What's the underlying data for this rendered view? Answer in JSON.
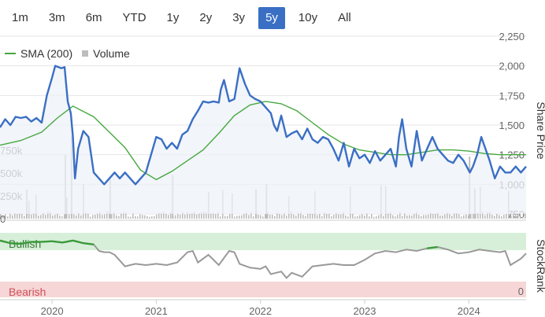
{
  "range_tabs": [
    {
      "label": "1m",
      "active": false
    },
    {
      "label": "3m",
      "active": false
    },
    {
      "label": "6m",
      "active": false
    },
    {
      "label": "YTD",
      "active": false
    },
    {
      "label": "1y",
      "active": false
    },
    {
      "label": "2y",
      "active": false
    },
    {
      "label": "3y",
      "active": false
    },
    {
      "label": "5y",
      "active": true
    },
    {
      "label": "10y",
      "active": false
    },
    {
      "label": "All",
      "active": false
    }
  ],
  "legend": {
    "sma_label": "SMA (200)",
    "volume_label": "Volume"
  },
  "colors": {
    "price": "#3a6fc4",
    "sma": "#46a83e",
    "volume": "#bdbdbd",
    "bullish_band": "#d7efd9",
    "bearish_band": "#f6d6d6",
    "bearish_text": "#d0505a",
    "bullish_text": "#3a7a3a",
    "stockrank_line": "#999999",
    "stockrank_bull": "#3a9a3a"
  },
  "chart_data": [
    {
      "type": "line",
      "ylabel": "Share Price",
      "y_ticks": [
        "2,250",
        "2,000",
        "1,750",
        "1,500",
        "1,250",
        "1,000",
        "750"
      ],
      "ylim": [
        750,
        2250
      ],
      "x_ticks": [
        "2020",
        "2021",
        "2022",
        "2023",
        "2024"
      ],
      "xlim": [
        2019.5,
        2024.55
      ],
      "series": [
        {
          "name": "SMA (200)",
          "x": [
            2019.5,
            2019.7,
            2019.9,
            2020.05,
            2020.2,
            2020.4,
            2020.55,
            2020.7,
            2020.85,
            2021.0,
            2021.15,
            2021.3,
            2021.45,
            2021.6,
            2021.75,
            2021.9,
            2022.05,
            2022.2,
            2022.35,
            2022.5,
            2022.65,
            2022.8,
            2022.95,
            2023.1,
            2023.25,
            2023.4,
            2023.55,
            2023.7,
            2023.85,
            2024.0,
            2024.15,
            2024.3,
            2024.45,
            2024.55
          ],
          "values": [
            1330,
            1370,
            1440,
            1560,
            1660,
            1570,
            1440,
            1310,
            1120,
            1040,
            1110,
            1200,
            1290,
            1430,
            1580,
            1670,
            1700,
            1680,
            1620,
            1520,
            1420,
            1340,
            1290,
            1270,
            1250,
            1250,
            1270,
            1290,
            1290,
            1280,
            1260,
            1250,
            1250,
            1250
          ]
        },
        {
          "name": "Price",
          "x": [
            2019.5,
            2019.55,
            2019.6,
            2019.65,
            2019.7,
            2019.75,
            2019.8,
            2019.85,
            2019.9,
            2019.95,
            2020.0,
            2020.03,
            2020.06,
            2020.09,
            2020.12,
            2020.15,
            2020.18,
            2020.2,
            2020.22,
            2020.25,
            2020.3,
            2020.35,
            2020.4,
            2020.45,
            2020.5,
            2020.55,
            2020.6,
            2020.65,
            2020.7,
            2020.75,
            2020.8,
            2020.85,
            2020.9,
            2020.95,
            2021.0,
            2021.05,
            2021.1,
            2021.15,
            2021.2,
            2021.25,
            2021.3,
            2021.35,
            2021.4,
            2021.45,
            2021.5,
            2021.55,
            2021.6,
            2021.62,
            2021.65,
            2021.7,
            2021.75,
            2021.8,
            2021.85,
            2021.9,
            2021.95,
            2022.0,
            2022.05,
            2022.1,
            2022.13,
            2022.16,
            2022.2,
            2022.25,
            2022.3,
            2022.35,
            2022.4,
            2022.45,
            2022.5,
            2022.55,
            2022.6,
            2022.65,
            2022.7,
            2022.75,
            2022.8,
            2022.85,
            2022.9,
            2022.95,
            2023.0,
            2023.05,
            2023.1,
            2023.15,
            2023.2,
            2023.25,
            2023.3,
            2023.33,
            2023.36,
            2023.4,
            2023.45,
            2023.5,
            2023.55,
            2023.6,
            2023.65,
            2023.7,
            2023.75,
            2023.8,
            2023.85,
            2023.9,
            2023.95,
            2023.98,
            2024.01,
            2024.04,
            2024.08,
            2024.12,
            2024.16,
            2024.2,
            2024.25,
            2024.3,
            2024.35,
            2024.4,
            2024.45,
            2024.5,
            2024.55
          ],
          "values": [
            1480,
            1550,
            1500,
            1570,
            1560,
            1570,
            1530,
            1560,
            1520,
            1750,
            1900,
            2000,
            1990,
            1980,
            1990,
            1700,
            1600,
            1400,
            1050,
            1300,
            1450,
            1400,
            1100,
            1050,
            1000,
            1050,
            1100,
            1050,
            1100,
            1050,
            1000,
            1050,
            1100,
            1250,
            1400,
            1380,
            1300,
            1350,
            1300,
            1420,
            1450,
            1550,
            1620,
            1700,
            1690,
            1700,
            1690,
            1800,
            1880,
            1700,
            1720,
            1980,
            1850,
            1750,
            1720,
            1700,
            1650,
            1600,
            1500,
            1450,
            1580,
            1400,
            1430,
            1450,
            1380,
            1470,
            1380,
            1350,
            1400,
            1380,
            1300,
            1200,
            1350,
            1150,
            1300,
            1220,
            1250,
            1180,
            1280,
            1200,
            1250,
            1300,
            1150,
            1400,
            1550,
            1300,
            1150,
            1450,
            1200,
            1300,
            1400,
            1300,
            1250,
            1200,
            1180,
            1250,
            1200,
            1150,
            1100,
            1150,
            1250,
            1400,
            1300,
            1200,
            1050,
            1150,
            1100,
            1100,
            1150,
            1100,
            1150
          ]
        }
      ]
    },
    {
      "type": "bar",
      "ylabel": "Volume",
      "y_ticks": [
        "750k",
        "500k",
        "250k",
        "0"
      ],
      "ylim": [
        0,
        1000000
      ],
      "series": [
        {
          "name": "Volume"
        }
      ]
    },
    {
      "type": "line",
      "ylabel": "StockRank",
      "y_ticks": [
        "0"
      ],
      "band_labels": {
        "bullish": "Bullish",
        "bearish": "Bearish"
      },
      "ylim": [
        0,
        100
      ],
      "series": [
        {
          "name": "StockRank",
          "x": [
            2019.5,
            2019.6,
            2019.7,
            2019.8,
            2019.9,
            2020.0,
            2020.1,
            2020.2,
            2020.3,
            2020.4,
            2020.45,
            2020.5,
            2020.55,
            2020.6,
            2020.7,
            2020.8,
            2020.9,
            2021.0,
            2021.1,
            2021.2,
            2021.3,
            2021.35,
            2021.4,
            2021.5,
            2021.6,
            2021.7,
            2021.75,
            2021.8,
            2021.9,
            2022.0,
            2022.05,
            2022.1,
            2022.2,
            2022.25,
            2022.3,
            2022.4,
            2022.5,
            2022.6,
            2022.7,
            2022.8,
            2022.9,
            2023.0,
            2023.1,
            2023.2,
            2023.3,
            2023.4,
            2023.5,
            2023.6,
            2023.7,
            2023.8,
            2023.9,
            2024.0,
            2024.1,
            2024.2,
            2024.3,
            2024.35,
            2024.4,
            2024.5,
            2024.55
          ],
          "values": [
            88,
            84,
            83,
            86,
            86,
            87,
            85,
            88,
            84,
            82,
            72,
            70,
            70,
            66,
            48,
            52,
            50,
            52,
            50,
            54,
            70,
            72,
            54,
            66,
            50,
            72,
            70,
            52,
            46,
            44,
            48,
            36,
            40,
            30,
            38,
            32,
            48,
            50,
            52,
            50,
            50,
            58,
            68,
            72,
            70,
            74,
            72,
            76,
            78,
            74,
            68,
            70,
            74,
            72,
            70,
            72,
            50,
            60,
            68
          ]
        }
      ]
    }
  ]
}
